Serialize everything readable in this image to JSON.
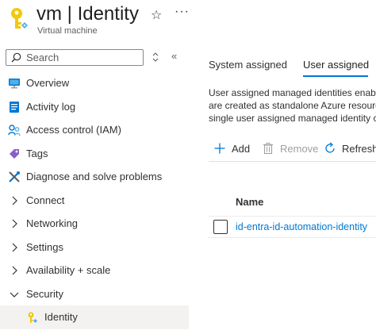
{
  "header": {
    "title": "vm | Identity",
    "subtitle": "Virtual machine",
    "favorite_icon": "star-icon",
    "more_icon": "more-icon"
  },
  "search": {
    "placeholder": "Search",
    "value": ""
  },
  "sidebar": {
    "items": [
      {
        "label": "Overview",
        "icon": "monitor-icon"
      },
      {
        "label": "Activity log",
        "icon": "activity-log-icon"
      },
      {
        "label": "Access control (IAM)",
        "icon": "people-icon"
      },
      {
        "label": "Tags",
        "icon": "tag-icon"
      },
      {
        "label": "Diagnose and solve problems",
        "icon": "wrench-icon"
      },
      {
        "label": "Connect",
        "icon": "chevron-right-icon"
      },
      {
        "label": "Networking",
        "icon": "chevron-right-icon"
      },
      {
        "label": "Settings",
        "icon": "chevron-right-icon"
      },
      {
        "label": "Availability + scale",
        "icon": "chevron-right-icon"
      },
      {
        "label": "Security",
        "icon": "chevron-down-icon"
      },
      {
        "label": "Identity",
        "icon": "key-icon",
        "selected": true
      }
    ]
  },
  "tabs": [
    {
      "label": "System assigned",
      "active": false
    },
    {
      "label": "User assigned",
      "active": true
    }
  ],
  "description": {
    "lines": [
      "User assigned managed identities enabl",
      "are created as standalone Azure resourc",
      "single user assigned managed identity c"
    ]
  },
  "toolbar": {
    "add_label": "Add",
    "remove_label": "Remove",
    "refresh_label": "Refresh"
  },
  "table": {
    "columns": [
      "Name"
    ],
    "rows": [
      {
        "name": "id-entra-id-automation-identity"
      }
    ]
  },
  "colors": {
    "accent": "#0078d4",
    "selected_bg": "#f3f2f1",
    "text": "#323130",
    "disabled": "#a19f9d"
  }
}
